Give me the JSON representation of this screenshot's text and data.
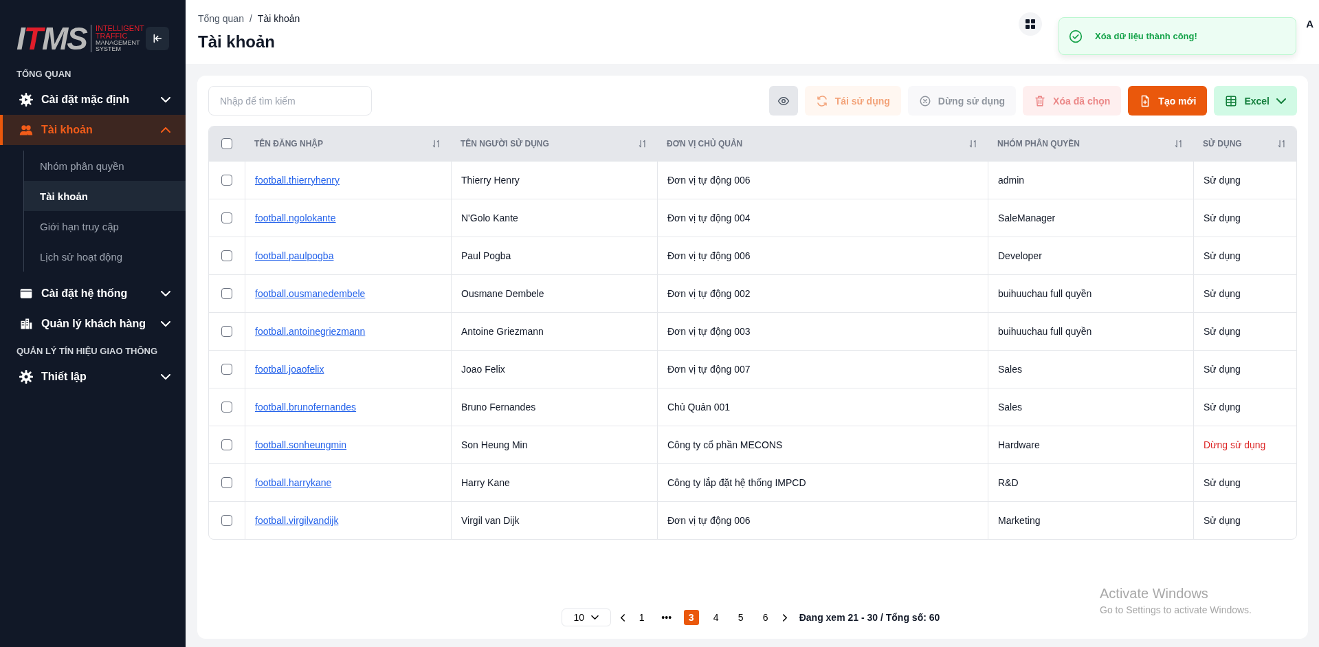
{
  "sidebar": {
    "logo": {
      "wordmark": [
        {
          "text": "I",
          "accent": false
        },
        {
          "text": "T",
          "accent": true
        },
        {
          "text": "MS",
          "accent": false
        }
      ],
      "tagline": [
        {
          "text": "INTELLIGENT",
          "accent": true
        },
        {
          "text": "TRAFFIC",
          "accent": true
        },
        {
          "text": "MANAGEMENT",
          "accent": false
        },
        {
          "text": "SYSTEM",
          "accent": false
        }
      ]
    },
    "nav": [
      {
        "kind": "section",
        "label": "TỔNG QUAN"
      },
      {
        "kind": "item",
        "label": "Cài đặt mặc định",
        "expanded": false,
        "selected": false
      },
      {
        "kind": "item",
        "label": "Tài khoản",
        "expanded": true,
        "selected": true,
        "children": [
          {
            "label": "Nhóm phân quyền",
            "selected": false
          },
          {
            "label": "Tài khoản",
            "selected": true
          },
          {
            "label": "Giới hạn truy cập",
            "selected": false
          },
          {
            "label": "Lịch sử hoạt động",
            "selected": false
          }
        ]
      },
      {
        "kind": "item",
        "label": "Cài đặt hệ thống",
        "expanded": false,
        "selected": false
      },
      {
        "kind": "item",
        "label": "Quản lý khách hàng",
        "expanded": false,
        "selected": false
      },
      {
        "kind": "section",
        "label": "QUẢN LÝ TÍN HIỆU GIAO THÔNG"
      },
      {
        "kind": "item",
        "label": "Thiết lập",
        "expanded": false,
        "selected": false
      }
    ]
  },
  "header": {
    "breadcrumb": [
      "Tổng quan",
      "Tài khoản"
    ],
    "separator": "/",
    "title": "Tài khoản",
    "user_fragment": "A"
  },
  "toast": {
    "message": "Xóa dữ liệu thành công!"
  },
  "toolbar": {
    "search": {
      "placeholder": "Nhập để tìm kiếm"
    },
    "buttons": [
      {
        "kind": "view",
        "disabled": false
      },
      {
        "kind": "reuse",
        "label": "Tái sử dụng",
        "disabled": true
      },
      {
        "kind": "stop",
        "label": "Dừng sử dụng",
        "disabled": true
      },
      {
        "kind": "delete",
        "label": "Xóa đã chọn",
        "disabled": true
      },
      {
        "kind": "create",
        "label": "Tạo mới",
        "disabled": false
      },
      {
        "kind": "export",
        "label": "Excel",
        "disabled": false
      }
    ]
  },
  "table": {
    "all_checked": false,
    "columns": [
      {
        "label": "TÊN ĐĂNG NHẬP",
        "sortable": true
      },
      {
        "label": "TÊN NGƯỜI SỬ DỤNG",
        "sortable": true
      },
      {
        "label": "ĐƠN VỊ CHỦ QUẢN",
        "sortable": true
      },
      {
        "label": "NHÓM PHÂN QUYỀN",
        "sortable": true
      },
      {
        "label": "SỬ DỤNG",
        "sortable": true
      }
    ],
    "rows": [
      {
        "checked": false,
        "login": "football.thierryhenry",
        "name": "Thierry Henry",
        "unit": "Đơn vị tự động 006",
        "group": "admin",
        "status": "Sử dụng",
        "active": true
      },
      {
        "checked": false,
        "login": "football.ngolokante",
        "name": "N'Golo Kante",
        "unit": "Đơn vị tự động 004",
        "group": "SaleManager",
        "status": "Sử dụng",
        "active": true
      },
      {
        "checked": false,
        "login": "football.paulpogba",
        "name": "Paul Pogba",
        "unit": "Đơn vị tự động 006",
        "group": "Developer",
        "status": "Sử dụng",
        "active": true
      },
      {
        "checked": false,
        "login": "football.ousmanedembele",
        "name": "Ousmane Dembele",
        "unit": "Đơn vị tự động 002",
        "group": "buihuuchau full quyền",
        "status": "Sử dụng",
        "active": true
      },
      {
        "checked": false,
        "login": "football.antoinegriezmann",
        "name": "Antoine Griezmann",
        "unit": "Đơn vị tự động 003",
        "group": "buihuuchau full quyền",
        "status": "Sử dụng",
        "active": true
      },
      {
        "checked": false,
        "login": "football.joaofelix",
        "name": "Joao Felix",
        "unit": "Đơn vị tự động 007",
        "group": "Sales",
        "status": "Sử dụng",
        "active": true
      },
      {
        "checked": false,
        "login": "football.brunofernandes",
        "name": "Bruno Fernandes",
        "unit": "Chủ Quản 001",
        "group": "Sales",
        "status": "Sử dụng",
        "active": true
      },
      {
        "checked": false,
        "login": "football.sonheungmin",
        "name": "Son Heung Min",
        "unit": "Công ty cổ phần MECONS",
        "group": "Hardware",
        "status": "Dừng sử dụng",
        "active": false
      },
      {
        "checked": false,
        "login": "football.harrykane",
        "name": "Harry Kane",
        "unit": "Công ty lắp đặt hệ thống IMPCD",
        "group": "R&D",
        "status": "Sử dụng",
        "active": true
      },
      {
        "checked": false,
        "login": "football.virgilvandijk",
        "name": "Virgil van Dijk",
        "unit": "Đơn vị tự động 006",
        "group": "Marketing",
        "status": "Sử dụng",
        "active": true
      }
    ]
  },
  "pagination": {
    "page_size": "10",
    "pages": [
      {
        "label": "1",
        "selected": false
      },
      {
        "label": "•••",
        "selected": false
      },
      {
        "label": "3",
        "selected": true
      },
      {
        "label": "4",
        "selected": false
      },
      {
        "label": "5",
        "selected": false
      },
      {
        "label": "6",
        "selected": false
      }
    ],
    "summary": "Đang xem 21 - 30 / Tổng số: 60"
  },
  "system_overlay": {
    "title": "Activate Windows",
    "subtitle": "Go to Settings to activate Windows."
  }
}
